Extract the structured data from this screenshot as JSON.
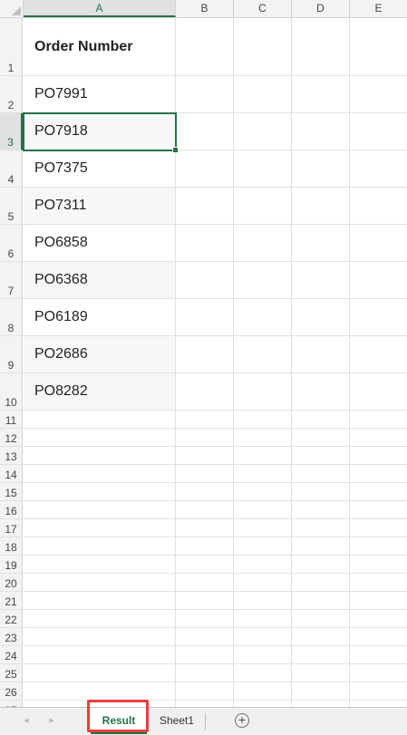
{
  "columns": [
    "A",
    "B",
    "C",
    "D",
    "E"
  ],
  "rows": [
    "1",
    "2",
    "3",
    "4",
    "5",
    "6",
    "7",
    "8",
    "9",
    "10",
    "11",
    "12",
    "13",
    "14",
    "15",
    "16",
    "17",
    "18",
    "19",
    "20",
    "21",
    "22",
    "23",
    "24",
    "25",
    "26",
    "27"
  ],
  "cells": {
    "header": "Order Number",
    "values": [
      "PO7991",
      "PO7918",
      "PO7375",
      "PO7311",
      "PO6858",
      "PO6368",
      "PO6189",
      "PO2686",
      "PO8282"
    ]
  },
  "selected_cell": "A3",
  "tabs": {
    "nav_prev": "◂",
    "nav_next": "▸",
    "sheet_result": "Result",
    "sheet_sheet1": "Sheet1",
    "add_sheet": "+"
  },
  "colors": {
    "accent": "#217346",
    "highlight": "#e8403a"
  }
}
